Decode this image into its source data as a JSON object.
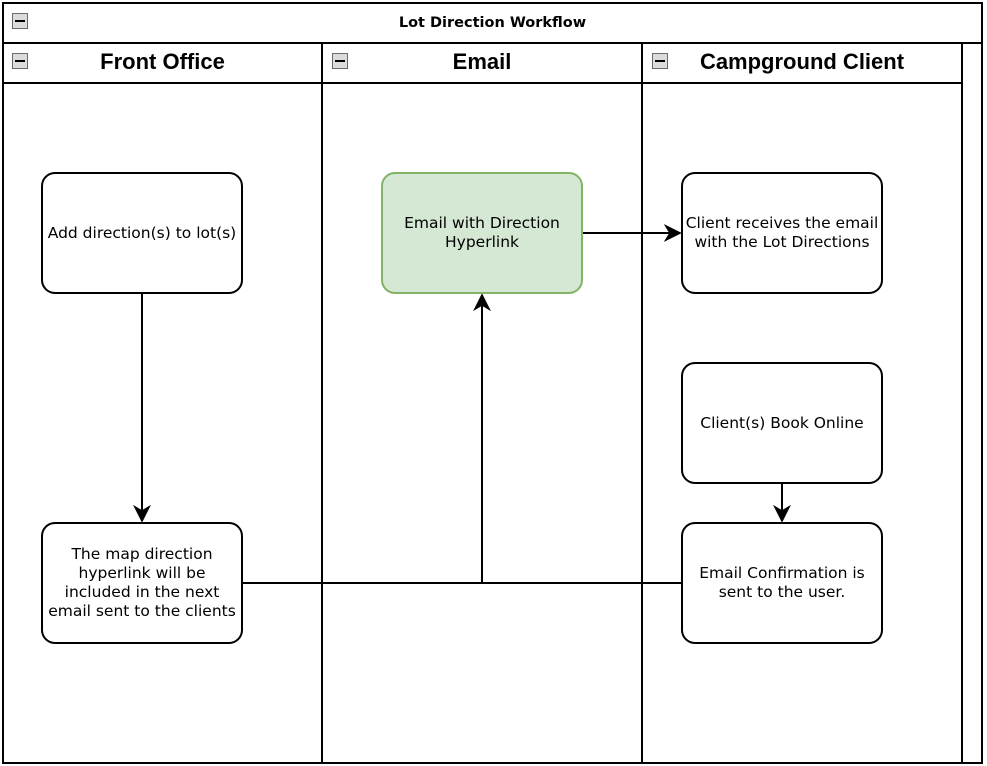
{
  "pool": {
    "title": "Lot Direction Workflow"
  },
  "lanes": [
    {
      "title": "Front Office"
    },
    {
      "title": "Email"
    },
    {
      "title": "Campground Client"
    }
  ],
  "nodes": {
    "add_directions": "Add direction(s) to lot(s)",
    "map_hyperlink": "The map direction  hyperlink will be included in the next email sent to the clients",
    "email_direction": "Email with Direction Hyperlink",
    "client_receives": "Client receives the email with the Lot Directions",
    "client_book": "Client(s) Book Online",
    "email_confirmation": "Email Confirmation is sent to the user."
  },
  "colors": {
    "highlight_fill": "#d5e8d4",
    "highlight_stroke": "#82b366",
    "line": "#000000"
  }
}
